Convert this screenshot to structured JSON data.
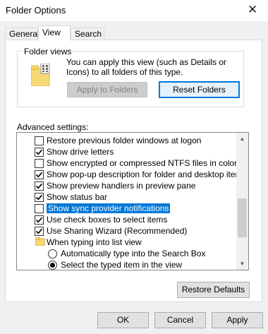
{
  "window": {
    "title": "Folder Options",
    "close_glyph": "✕"
  },
  "tabs": [
    {
      "label": "General"
    },
    {
      "label": "View"
    },
    {
      "label": "Search"
    }
  ],
  "folder_views": {
    "legend": "Folder views",
    "description": "You can apply this view (such as Details or Icons) to all folders of this type.",
    "apply_button": "Apply to Folders",
    "reset_button": "Reset Folders"
  },
  "advanced": {
    "label": "Advanced settings:",
    "items": [
      {
        "type": "checkbox",
        "checked": false,
        "label": "Restore previous folder windows at logon"
      },
      {
        "type": "checkbox",
        "checked": true,
        "label": "Show drive letters"
      },
      {
        "type": "checkbox",
        "checked": false,
        "label": "Show encrypted or compressed NTFS files in color"
      },
      {
        "type": "checkbox",
        "checked": true,
        "label": "Show pop-up description for folder and desktop items"
      },
      {
        "type": "checkbox",
        "checked": true,
        "label": "Show preview handlers in preview pane"
      },
      {
        "type": "checkbox",
        "checked": true,
        "label": "Show status bar"
      },
      {
        "type": "checkbox",
        "checked": false,
        "selected": true,
        "label": "Show sync provider notifications"
      },
      {
        "type": "checkbox",
        "checked": true,
        "label": "Use check boxes to select items"
      },
      {
        "type": "checkbox",
        "checked": true,
        "label": "Use Sharing Wizard (Recommended)"
      },
      {
        "type": "folder",
        "label": "When typing into list view"
      },
      {
        "type": "radio",
        "checked": false,
        "label": "Automatically type into the Search Box"
      },
      {
        "type": "radio",
        "checked": true,
        "label": "Select the typed item in the view"
      }
    ]
  },
  "restore_defaults": "Restore Defaults",
  "footer": {
    "ok": "OK",
    "cancel": "Cancel",
    "apply": "Apply"
  },
  "colors": {
    "accent": "#0078d7",
    "selection": "#0078d7",
    "folder": "#f8d775"
  }
}
